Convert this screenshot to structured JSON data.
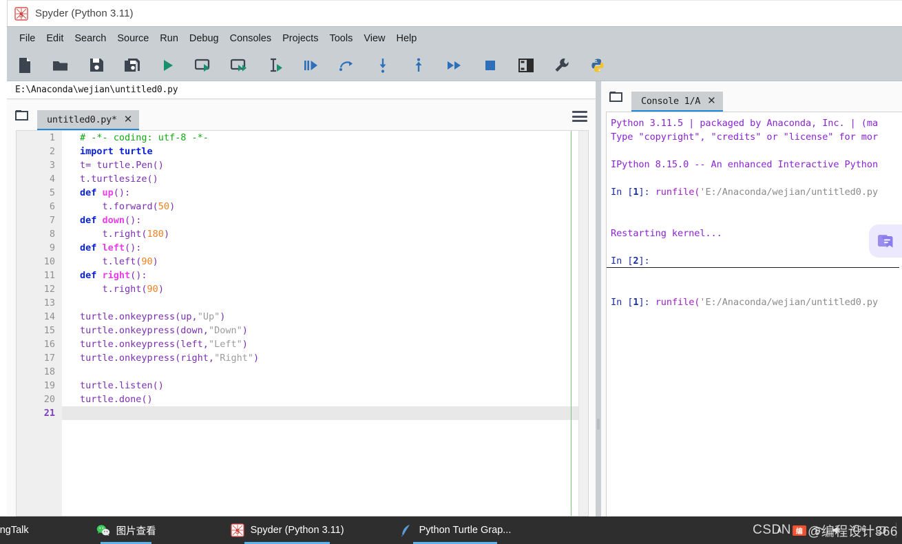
{
  "window": {
    "title": "Spyder (Python 3.11)",
    "app_icon": "spyder-logo-icon"
  },
  "menubar": {
    "items": [
      "File",
      "Edit",
      "Search",
      "Source",
      "Run",
      "Debug",
      "Consoles",
      "Projects",
      "Tools",
      "View",
      "Help"
    ]
  },
  "toolbar": {
    "buttons": [
      {
        "name": "new-file-icon",
        "title": "New file"
      },
      {
        "name": "open-file-icon",
        "title": "Open file"
      },
      {
        "name": "save-file-icon",
        "title": "Save file"
      },
      {
        "name": "save-all-icon",
        "title": "Save all"
      },
      {
        "name": "run-file-icon",
        "title": "Run file"
      },
      {
        "name": "run-cell-icon",
        "title": "Run current cell"
      },
      {
        "name": "run-cell-advance-icon",
        "title": "Run current cell and go to the next one"
      },
      {
        "name": "run-selection-icon",
        "title": "Run selection"
      },
      {
        "name": "debug-file-icon",
        "title": "Debug file"
      },
      {
        "name": "step-over-icon",
        "title": "Run current line"
      },
      {
        "name": "step-into-icon",
        "title": "Step into function"
      },
      {
        "name": "step-return-icon",
        "title": "Run until function returns"
      },
      {
        "name": "continue-icon",
        "title": "Continue execution"
      },
      {
        "name": "stop-debug-icon",
        "title": "Stop debugging"
      },
      {
        "name": "panes-layout-icon",
        "title": "Panes layout"
      },
      {
        "name": "preferences-wrench-icon",
        "title": "Preferences"
      },
      {
        "name": "python-path-icon",
        "title": "Python interpreter"
      }
    ]
  },
  "pathbar": {
    "path": "E:\\Anaconda\\wejian\\untitled0.py"
  },
  "editor": {
    "browse_icon": "browse-tabs-icon",
    "tab_label": "untitled0.py*",
    "tab_close": "✕",
    "options_icon": "options-hamburger-icon",
    "current_line": 21,
    "lines": [
      {
        "n": 1,
        "tokens": [
          {
            "t": "# -*- coding: utf-8 -*-",
            "c": "t-com"
          }
        ]
      },
      {
        "n": 2,
        "tokens": [
          {
            "t": "import",
            "c": "t-kw"
          },
          {
            "t": " turtle",
            "c": "t-kw"
          }
        ]
      },
      {
        "n": 3,
        "tokens": [
          {
            "t": "t= turtle.Pen()",
            "c": "t-id"
          }
        ]
      },
      {
        "n": 4,
        "tokens": [
          {
            "t": "t.turtlesize()",
            "c": "t-id"
          }
        ]
      },
      {
        "n": 5,
        "tokens": [
          {
            "t": "def ",
            "c": "t-kw"
          },
          {
            "t": "up",
            "c": "t-fn"
          },
          {
            "t": "():",
            "c": "t-id"
          }
        ]
      },
      {
        "n": 6,
        "tokens": [
          {
            "t": "    t.forward(",
            "c": "t-id"
          },
          {
            "t": "50",
            "c": "t-num"
          },
          {
            "t": ")",
            "c": "t-id"
          }
        ]
      },
      {
        "n": 7,
        "tokens": [
          {
            "t": "def ",
            "c": "t-kw"
          },
          {
            "t": "down",
            "c": "t-fn"
          },
          {
            "t": "():",
            "c": "t-id"
          }
        ]
      },
      {
        "n": 8,
        "tokens": [
          {
            "t": "    t.right(",
            "c": "t-id"
          },
          {
            "t": "180",
            "c": "t-num"
          },
          {
            "t": ")",
            "c": "t-id"
          }
        ]
      },
      {
        "n": 9,
        "tokens": [
          {
            "t": "def ",
            "c": "t-kw"
          },
          {
            "t": "left",
            "c": "t-fn"
          },
          {
            "t": "():",
            "c": "t-id"
          }
        ]
      },
      {
        "n": 10,
        "tokens": [
          {
            "t": "    t.left(",
            "c": "t-id"
          },
          {
            "t": "90",
            "c": "t-num"
          },
          {
            "t": ")",
            "c": "t-id"
          }
        ]
      },
      {
        "n": 11,
        "tokens": [
          {
            "t": "def ",
            "c": "t-kw"
          },
          {
            "t": "right",
            "c": "t-fn"
          },
          {
            "t": "():",
            "c": "t-id"
          }
        ]
      },
      {
        "n": 12,
        "tokens": [
          {
            "t": "    t.right(",
            "c": "t-id"
          },
          {
            "t": "90",
            "c": "t-num"
          },
          {
            "t": ")",
            "c": "t-id"
          }
        ]
      },
      {
        "n": 13,
        "tokens": [
          {
            "t": "",
            "c": "t-id"
          }
        ]
      },
      {
        "n": 14,
        "tokens": [
          {
            "t": "turtle.onkeypress(up,",
            "c": "t-id"
          },
          {
            "t": "\"Up\"",
            "c": "t-str"
          },
          {
            "t": ")",
            "c": "t-id"
          }
        ]
      },
      {
        "n": 15,
        "tokens": [
          {
            "t": "turtle.onkeypress(down,",
            "c": "t-id"
          },
          {
            "t": "\"Down\"",
            "c": "t-str"
          },
          {
            "t": ")",
            "c": "t-id"
          }
        ]
      },
      {
        "n": 16,
        "tokens": [
          {
            "t": "turtle.onkeypress(left,",
            "c": "t-id"
          },
          {
            "t": "\"Left\"",
            "c": "t-str"
          },
          {
            "t": ")",
            "c": "t-id"
          }
        ]
      },
      {
        "n": 17,
        "tokens": [
          {
            "t": "turtle.onkeypress(right,",
            "c": "t-id"
          },
          {
            "t": "\"Right\"",
            "c": "t-str"
          },
          {
            "t": ")",
            "c": "t-id"
          }
        ]
      },
      {
        "n": 18,
        "tokens": [
          {
            "t": "",
            "c": "t-id"
          }
        ]
      },
      {
        "n": 19,
        "tokens": [
          {
            "t": "turtle.listen()",
            "c": "t-id"
          }
        ]
      },
      {
        "n": 20,
        "tokens": [
          {
            "t": "turtle.done()",
            "c": "t-id"
          }
        ]
      },
      {
        "n": 21,
        "tokens": [
          {
            "t": "",
            "c": "t-id"
          }
        ]
      }
    ]
  },
  "console": {
    "browse_icon": "browse-tabs-icon",
    "tab_label": "Console 1/A",
    "tab_close": "✕",
    "lines": [
      {
        "id": "banner-1",
        "blank": false,
        "prompt": false,
        "segs": [
          {
            "t": "Python 3.11.5 | packaged by Anaconda, Inc. | (ma",
            "c": "c-out"
          }
        ]
      },
      {
        "id": "banner-2",
        "blank": false,
        "prompt": false,
        "segs": [
          {
            "t": "Type \"copyright\", \"credits\" or \"license\" for mor",
            "c": "c-out"
          }
        ]
      },
      {
        "id": "blank-1",
        "blank": true,
        "prompt": false,
        "segs": []
      },
      {
        "id": "banner-3",
        "blank": false,
        "prompt": false,
        "segs": [
          {
            "t": "IPython 8.15.0 -- An enhanced Interactive Python",
            "c": "c-out"
          }
        ]
      },
      {
        "id": "blank-2",
        "blank": true,
        "prompt": false,
        "segs": []
      },
      {
        "id": "in-1",
        "blank": false,
        "prompt": false,
        "segs": [
          {
            "t": "In [",
            "c": "c-in"
          },
          {
            "t": "1",
            "c": "c-num"
          },
          {
            "t": "]: ",
            "c": "c-in"
          },
          {
            "t": "runfile(",
            "c": "c-fn"
          },
          {
            "t": "'E:/Anaconda/wejian/untitled0.py",
            "c": "c-str"
          }
        ]
      },
      {
        "id": "blank-3",
        "blank": true,
        "prompt": false,
        "segs": []
      },
      {
        "id": "blank-4",
        "blank": true,
        "prompt": false,
        "segs": []
      },
      {
        "id": "restart",
        "blank": false,
        "prompt": false,
        "segs": [
          {
            "t": "Restarting kernel...",
            "c": "c-out"
          }
        ]
      },
      {
        "id": "blank-5",
        "blank": true,
        "prompt": false,
        "segs": []
      },
      {
        "id": "in-2",
        "blank": false,
        "prompt": true,
        "segs": [
          {
            "t": "In [",
            "c": "c-in"
          },
          {
            "t": "2",
            "c": "c-num"
          },
          {
            "t": "]:",
            "c": "c-in"
          }
        ]
      },
      {
        "id": "blank-6",
        "blank": true,
        "prompt": false,
        "segs": []
      },
      {
        "id": "blank-7",
        "blank": true,
        "prompt": false,
        "segs": []
      },
      {
        "id": "in-3",
        "blank": false,
        "prompt": false,
        "segs": [
          {
            "t": "In [",
            "c": "c-in"
          },
          {
            "t": "1",
            "c": "c-num"
          },
          {
            "t": "]: ",
            "c": "c-in"
          },
          {
            "t": "runfile(",
            "c": "c-fn"
          },
          {
            "t": "'E:/Anaconda/wejian/untitled0.py",
            "c": "c-str"
          }
        ]
      }
    ]
  },
  "floating_widget": {
    "icon": "notes-bookmark-icon"
  },
  "taskbar": {
    "items": [
      {
        "label": "DingTalk",
        "icon": "dingtalk-icon",
        "active": false,
        "partial": true
      },
      {
        "label": "图片查看",
        "icon": "wechat-icon",
        "active": true,
        "partial": false
      },
      {
        "label": "Spyder (Python 3.11)",
        "icon": "spyder-logo-icon",
        "active": true,
        "partial": false
      },
      {
        "label": "Python Turtle Grap...",
        "icon": "python-feather-icon",
        "active": true,
        "partial": false
      }
    ],
    "tray": {
      "chevron": "∧",
      "clock_time": "4:06",
      "clock_date": "",
      "icons": [
        "sogou-input-icon",
        "network-icon",
        "speaker-icon",
        "notification-icon"
      ]
    }
  },
  "watermark": {
    "prefix": "CSDN",
    "badge": "编",
    "suffix": "@编程设计366"
  },
  "colors": {
    "toolbar_bg": "#c9cfd3",
    "tab_active_underline": "#1e8ad6",
    "comment_green": "#12a712",
    "keyword_blue": "#0a22d6",
    "function_magenta": "#e83ee8",
    "identifier_purple": "#7a2fb0",
    "number_orange": "#f08020",
    "string_gray": "#9b9b9b",
    "console_output_purple": "#8b23d6",
    "console_prompt_blue": "#1b2ea8",
    "taskbar_bg": "#2e2e2e",
    "margin_line_green": "#7cc47c"
  }
}
